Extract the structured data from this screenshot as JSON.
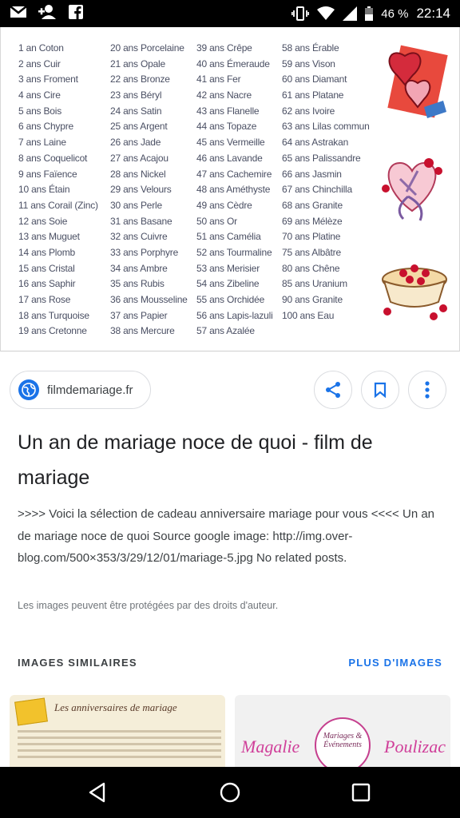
{
  "status_bar": {
    "battery": "46 %",
    "time": "22:14"
  },
  "anniversaries": {
    "col1": [
      "1 an Coton",
      "2 ans Cuir",
      "3 ans Froment",
      "4 ans Cire",
      "5 ans Bois",
      "6 ans Chypre",
      "7 ans Laine",
      "8 ans Coquelicot",
      "9 ans Faïence",
      "10 ans Étain",
      "11 ans Corail (Zinc)",
      "12 ans Soie",
      "13 ans Muguet",
      "14 ans Plomb",
      "15 ans Cristal",
      "16 ans Saphir",
      "17 ans Rose",
      "18 ans Turquoise",
      "19 ans Cretonne"
    ],
    "col2": [
      "20 ans Porcelaine",
      "21 ans Opale",
      "22 ans Bronze",
      "23 ans Béryl",
      "24 ans Satin",
      "25 ans Argent",
      "26 ans Jade",
      "27 ans Acajou",
      "28 ans Nickel",
      "29 ans Velours",
      "30 ans Perle",
      "31 ans Basane",
      "32 ans Cuivre",
      "33 ans Porphyre",
      "34 ans Ambre",
      "35 ans Rubis",
      "36 ans Mousseline",
      "37 ans Papier",
      "38 ans Mercure"
    ],
    "col3": [
      "39 ans Crêpe",
      "40 ans Émeraude",
      "41 ans Fer",
      "42 ans Nacre",
      "43 ans Flanelle",
      "44 ans Topaze",
      "45 ans Vermeille",
      "46 ans Lavande",
      "47 ans Cachemire",
      "48 ans Améthyste",
      "49 ans Cèdre",
      "50 ans Or",
      "51 ans Camélia",
      "52 ans Tourmaline",
      "53 ans Merisier",
      "54 ans Zibeline",
      "55 ans Orchidée",
      "56 ans Lapis-lazuli",
      "57 ans Azalée"
    ],
    "col4": [
      "58 ans Érable",
      "59 ans Vison",
      "60 ans Diamant",
      "61 ans Platane",
      "62 ans Ivoire",
      "63 ans Lilas commun",
      "64 ans Astrakan",
      "65 ans Palissandre",
      "66 ans Jasmin",
      "67 ans Chinchilla",
      "68 ans Granite",
      "69 ans Mélèze",
      "70 ans Platine",
      "75 ans Albâtre",
      "80 ans Chêne",
      "85 ans Uranium",
      "90 ans Granite",
      "100 ans Eau"
    ]
  },
  "source": {
    "domain": "filmdemariage.fr",
    "icon": "globe-icon"
  },
  "actions": {
    "share_icon": "share-icon",
    "bookmark_icon": "bookmark-icon",
    "more_icon": "more-vert-icon"
  },
  "result": {
    "title": "Un an de mariage noce de quoi - film de mariage",
    "description": ">>>> Voici la sélection de cadeau anniversaire mariage pour vous <<<< Un an de mariage noce de quoi Source google image: http://img.over-blog.com/500×353/3/29/12/01/mariage-5.jpg No related posts.",
    "copyright": "Les images peuvent être protégées par des droits d'auteur."
  },
  "similar": {
    "header": "IMAGES SIMILAIRES",
    "more_link": "PLUS D'IMAGES",
    "thumb1_title": "Les anniversaires de mariage",
    "thumb2_left": "Magalie",
    "thumb2_right": "Poulizac",
    "thumb2_ring": "Mariages & Événements"
  },
  "colors": {
    "accent": "#1a73e8",
    "text": "#202124",
    "muted": "#70757a"
  }
}
